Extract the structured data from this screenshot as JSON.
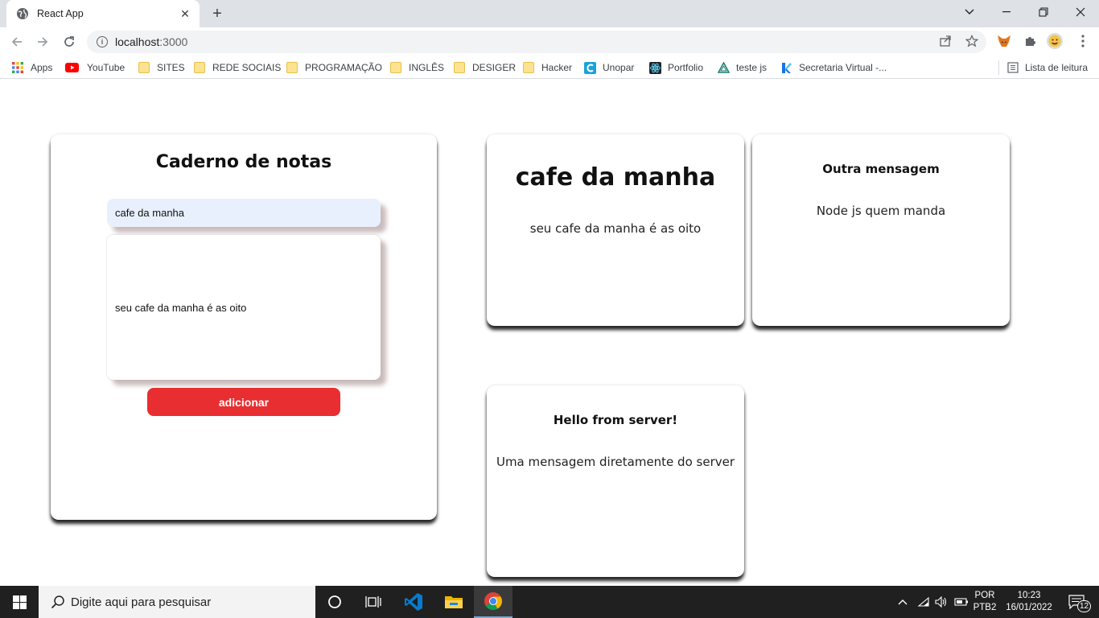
{
  "browser": {
    "tab_title": "React App",
    "url_host": "localhost",
    "url_port": ":3000",
    "bookmarks": [
      {
        "label": "Apps",
        "icon": "apps-grid-icon"
      },
      {
        "label": "YouTube",
        "icon": "youtube-icon"
      },
      {
        "label": "SITES",
        "icon": "folder-icon"
      },
      {
        "label": "REDE SOCIAIS",
        "icon": "folder-icon"
      },
      {
        "label": "PROGRAMAÇÃO",
        "icon": "folder-icon"
      },
      {
        "label": "INGLÊS",
        "icon": "folder-icon"
      },
      {
        "label": "DESIGER",
        "icon": "folder-icon"
      },
      {
        "label": "Hacker",
        "icon": "folder-icon"
      },
      {
        "label": "Unopar",
        "icon": "unopar-icon"
      },
      {
        "label": "Portfolio",
        "icon": "react-icon"
      },
      {
        "label": "teste js",
        "icon": "triangle-icon"
      },
      {
        "label": "Secretaria Virtual -...",
        "icon": "k-icon"
      }
    ],
    "reading_list": "Lista de leitura"
  },
  "notebook": {
    "title": "Caderno de notas",
    "title_input_value": "cafe da manha",
    "content_value": "seu cafe da manha é as oito",
    "add_button": "adicionar"
  },
  "notes": [
    {
      "title": "cafe da manha",
      "body": "seu cafe da manha é as oito"
    },
    {
      "title": "Outra mensagem",
      "body": "Node js quem manda"
    },
    {
      "title": "Hello from server!",
      "body": "Uma mensagem diretamente do server"
    }
  ],
  "taskbar": {
    "search_placeholder": "Digite aqui para pesquisar",
    "lang_top": "POR",
    "lang_bottom": "PTB2",
    "time": "10:23",
    "date": "16/01/2022",
    "notifications": "12"
  },
  "colors": {
    "accent_red": "#e82e30",
    "input_fill": "#e8f0fe"
  }
}
